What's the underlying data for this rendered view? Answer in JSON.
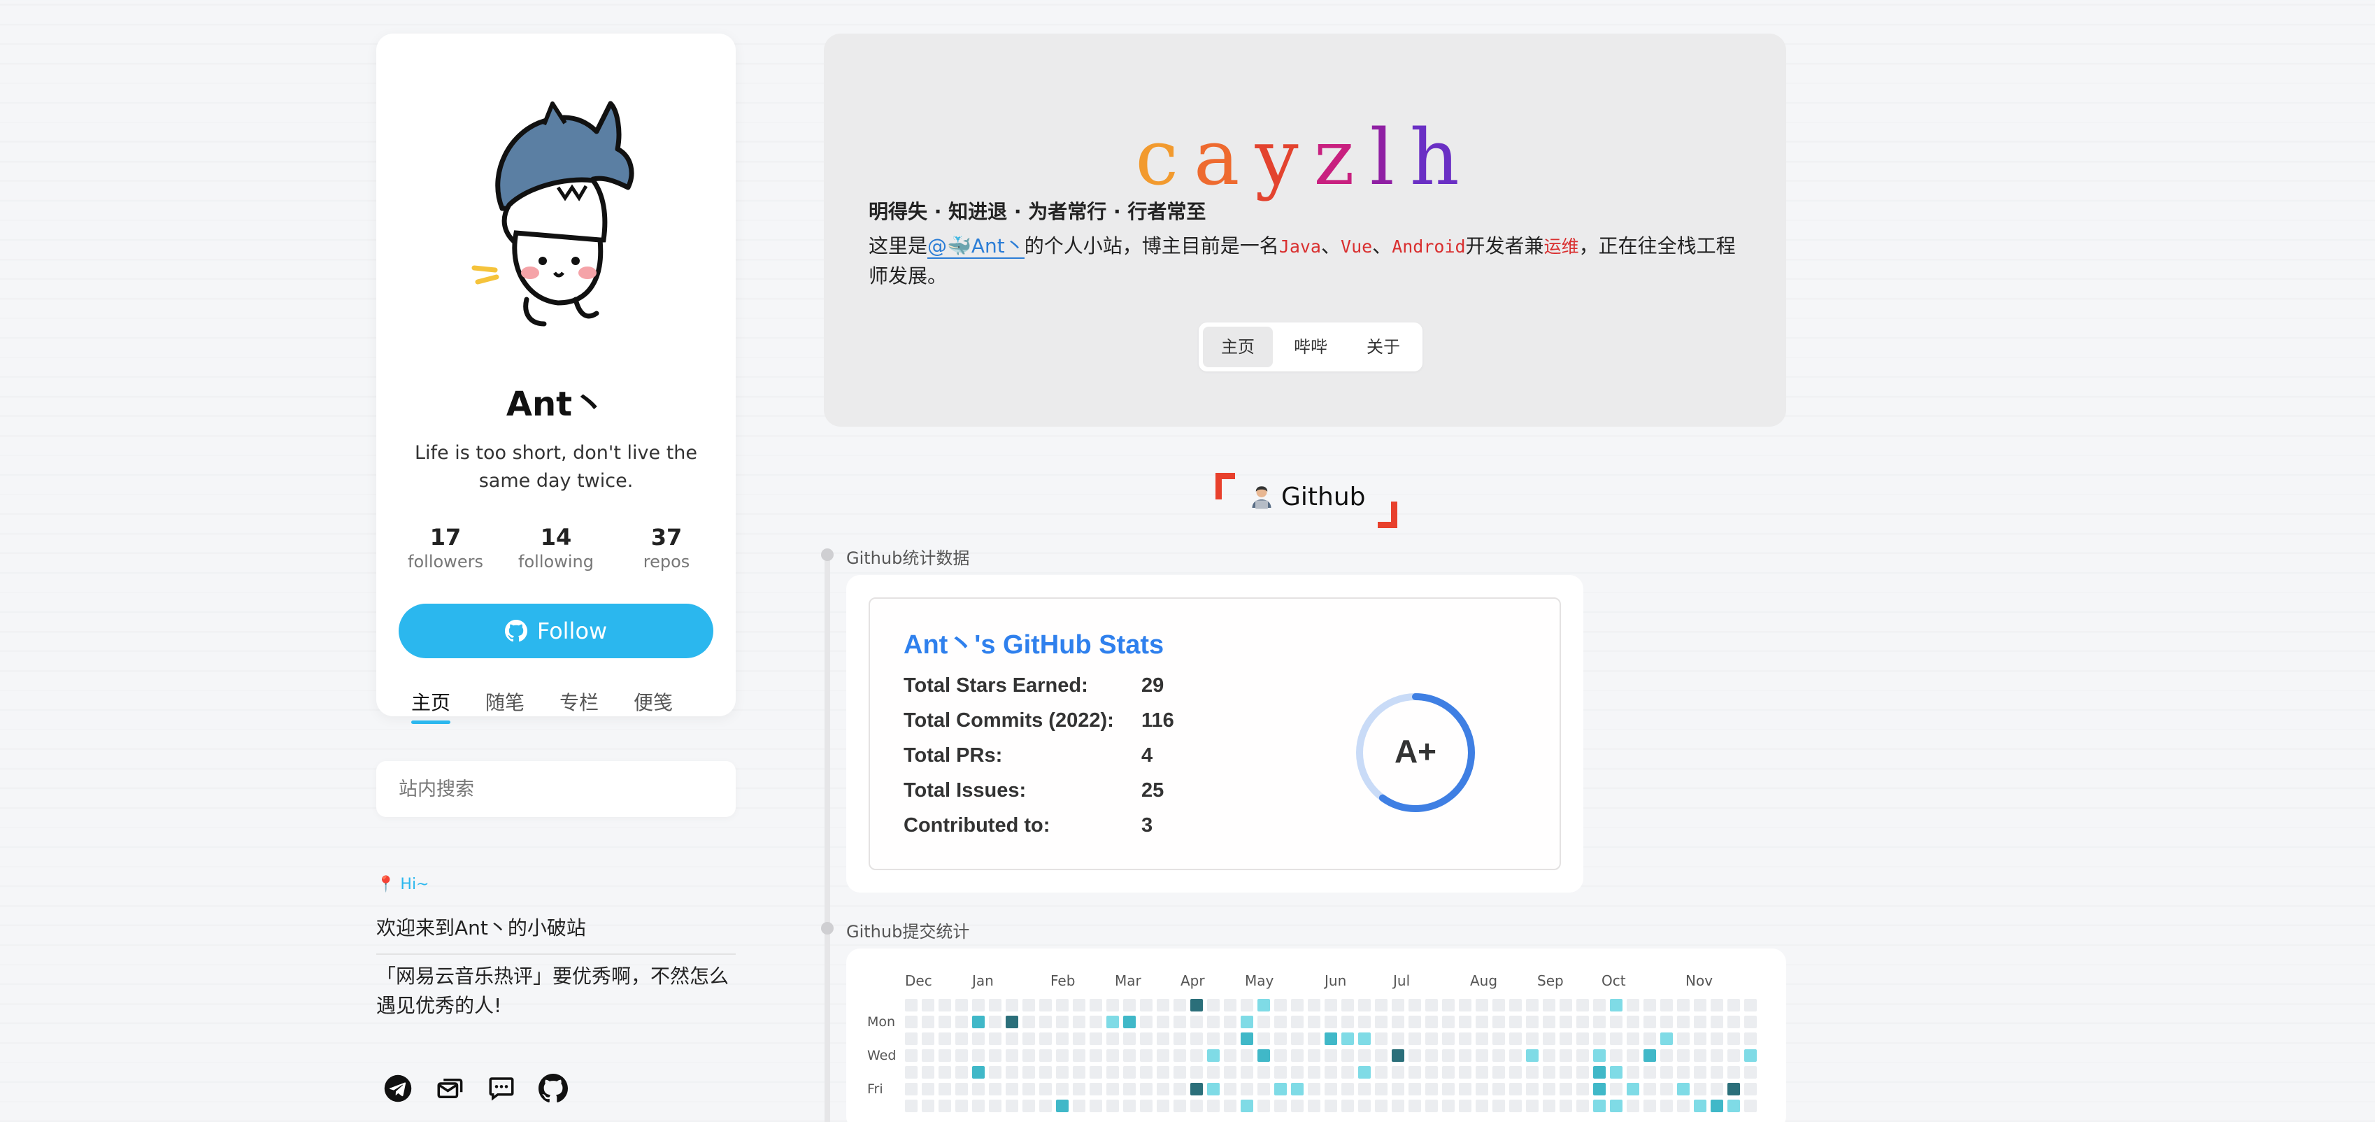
{
  "profile": {
    "name": "Ant丶",
    "bio": "Life is too short, don't live the same day twice.",
    "stats": [
      {
        "num": "17",
        "label": "followers"
      },
      {
        "num": "14",
        "label": "following"
      },
      {
        "num": "37",
        "label": "repos"
      }
    ],
    "follow_label": "Follow",
    "tabs": [
      "主页",
      "随笔",
      "专栏",
      "便笺"
    ],
    "active_tab": 0
  },
  "search": {
    "placeholder": "站内搜索"
  },
  "greeting": {
    "hi": "Hi~",
    "welcome": "欢迎来到Ant丶的小破站",
    "quote": "「网易云音乐热评」要优秀啊，不然怎么遇见优秀的人!"
  },
  "social_icons": [
    "telegram-icon",
    "mail-icon",
    "message-icon",
    "github-icon"
  ],
  "header": {
    "title_letters": [
      "c",
      "a",
      "y",
      "z",
      "l",
      "h"
    ],
    "title_colors": [
      "#f29a2e",
      "#ee6a2f",
      "#e3432f",
      "#c8207f",
      "#8f1fa3",
      "#6a2fc4"
    ],
    "motto": "明得失 · 知进退 · 为者常行 · 行者常至",
    "intro": {
      "before": "这里是",
      "link": "@🐳Ant丶",
      "mid1": "的个人小站，博主目前是一名",
      "code1": "Java",
      "sep1": "、",
      "code2": "Vue",
      "sep2": "、",
      "code3": "Android",
      "mid2": "开发者兼",
      "code4": "运维",
      "after": "，正在往全栈工程师发展。"
    },
    "nav": [
      "主页",
      "哔哔",
      "关于"
    ]
  },
  "github_section": {
    "heading": "Github",
    "stats_label": "Github统计数据",
    "commits_label": "Github提交统计"
  },
  "github_stats": {
    "title": "Ant丶's GitHub Stats",
    "rows": [
      {
        "key": "Total Stars Earned:",
        "value": "29"
      },
      {
        "key": "Total Commits (2022):",
        "value": "116"
      },
      {
        "key": "Total PRs:",
        "value": "4"
      },
      {
        "key": "Total Issues:",
        "value": "25"
      },
      {
        "key": "Contributed to:",
        "value": "3"
      }
    ],
    "grade": "A+",
    "grade_progress": 0.6,
    "accent": "#2f80ed"
  },
  "contributions": {
    "months": [
      "Dec",
      "Jan",
      "Feb",
      "Mar",
      "Apr",
      "May",
      "Jun",
      "Jul",
      "Aug",
      "Sep",
      "Oct",
      "Nov"
    ],
    "days": [
      "Mon",
      "Wed",
      "Fri"
    ],
    "colors": [
      "#ebedf0",
      "#7fdbe6",
      "#40b8c8",
      "#2b6f7a"
    ]
  }
}
